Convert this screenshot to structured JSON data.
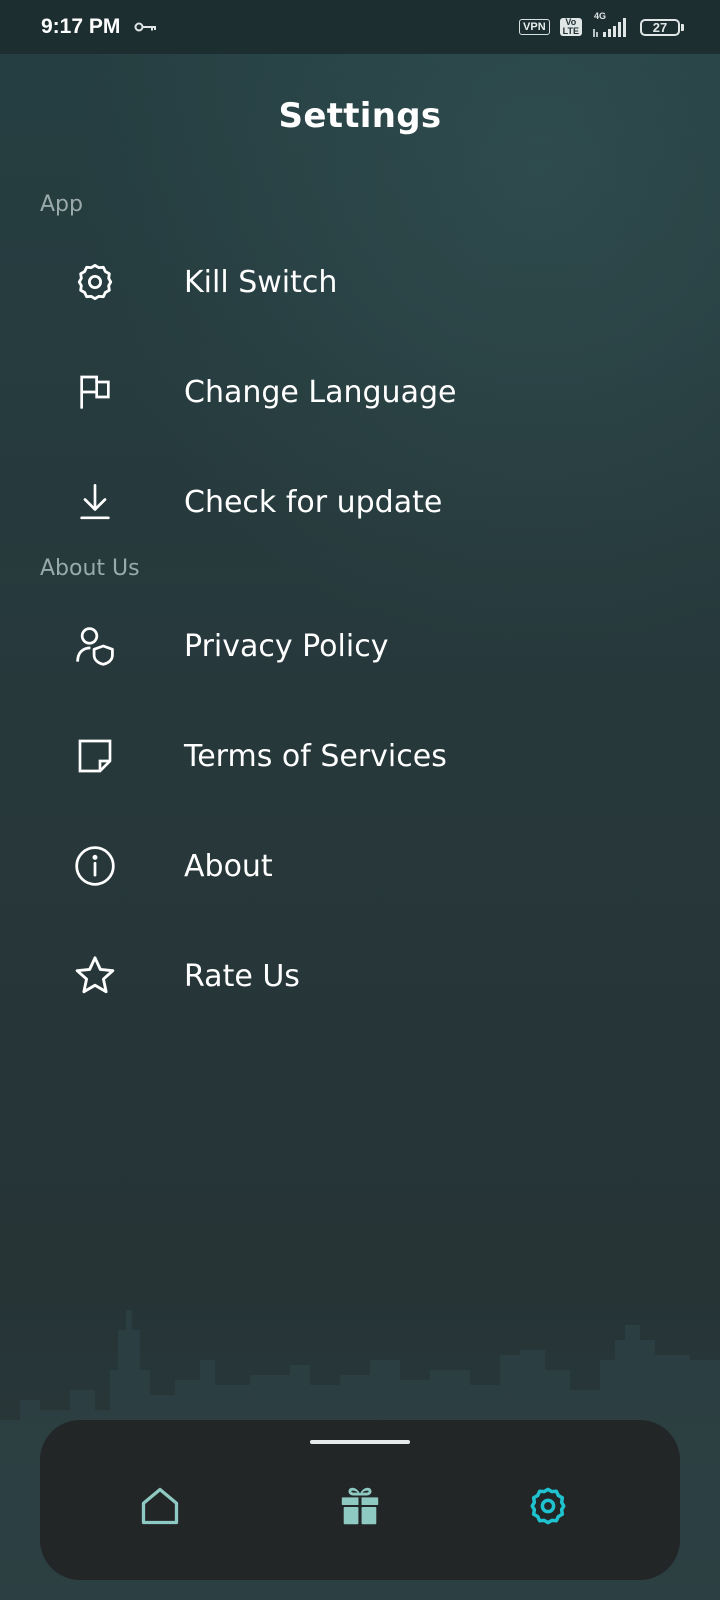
{
  "status_bar": {
    "time": "9:17 PM",
    "vpn_badge": "VPN",
    "volte_top": "Vo",
    "volte_bottom": "LTE",
    "network_type": "4G",
    "battery": "27"
  },
  "header": {
    "title": "Settings"
  },
  "sections": [
    {
      "label": "App",
      "items": [
        {
          "label": "Kill Switch",
          "icon": "gear-icon"
        },
        {
          "label": "Change Language",
          "icon": "flag-icon"
        },
        {
          "label": "Check for update",
          "icon": "download-icon"
        }
      ]
    },
    {
      "label": "About Us",
      "items": [
        {
          "label": "Privacy Policy",
          "icon": "user-shield-icon"
        },
        {
          "label": "Terms of Services",
          "icon": "note-icon"
        },
        {
          "label": "About",
          "icon": "info-icon"
        },
        {
          "label": "Rate Us",
          "icon": "star-icon"
        }
      ]
    }
  ],
  "bottom_nav": {
    "items": [
      {
        "name": "home",
        "icon": "home-icon",
        "active": false
      },
      {
        "name": "gift",
        "icon": "gift-icon",
        "active": false
      },
      {
        "name": "settings",
        "icon": "gear-icon",
        "active": true
      }
    ],
    "inactive_color": "#8ec9c2",
    "active_color": "#1fc3d0"
  },
  "colors": {
    "background": "#27383b",
    "section_label": "#9aaaab",
    "nav_background": "#232627"
  }
}
